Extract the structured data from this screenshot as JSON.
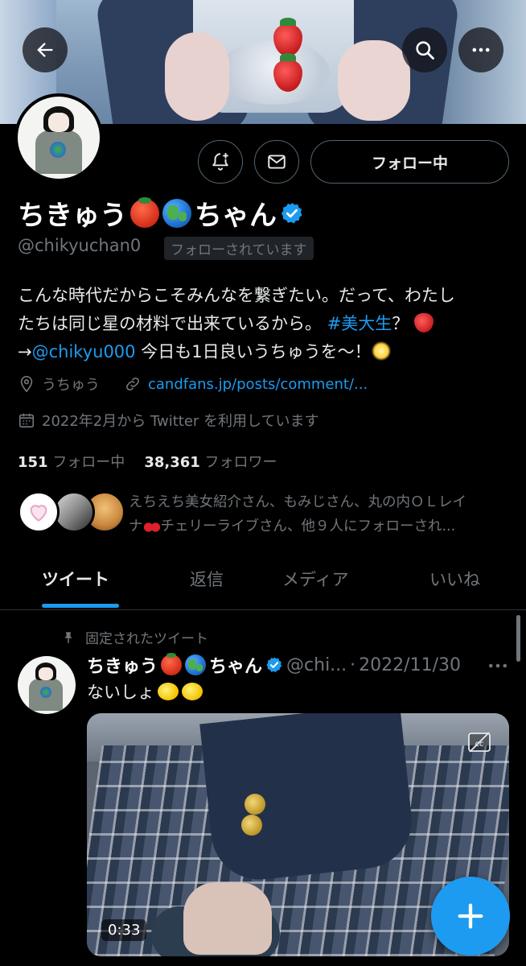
{
  "header": {
    "back_icon": "arrow-left-icon",
    "search_icon": "search-icon",
    "more_icon": "more-horizontal-icon"
  },
  "profile": {
    "name": "ちきゅう",
    "name_emojis": [
      "tomato",
      "globe-americas"
    ],
    "name_suffix": "ちゃん",
    "verified": true,
    "handle": "@chikyuchan0",
    "follows_you": "フォローされています",
    "follow_button": "フォロー中",
    "bio": {
      "line1": "こんな時代だからこそみんなを繋ぎたい。だって、わたし",
      "line2": "たちは同じ星の材料で出来ているから。",
      "hashtag": "#美大生",
      "hashtag_suffix": "？",
      "line3_prefix": "→",
      "mention": "@chikyu000",
      "line3_suffix": "今日も1日良いうちゅうを〜！"
    },
    "location": "うちゅう",
    "website": "candfans.jp/posts/comment/...",
    "joined": "2022年2月から Twitter を利用しています",
    "following_count": "151",
    "following_label": "フォロー中",
    "followers_count": "38,361",
    "followers_label": "フォロワー",
    "known_followers_line1": "えちえち美女紹介さん、もみじさん、丸の内ＯＬレイ",
    "known_followers_line2_a": "ナ",
    "known_followers_line2_b": "チェリーライブさん、他９人にフォローされ..."
  },
  "tabs": [
    {
      "label": "ツイート",
      "active": true
    },
    {
      "label": "返信",
      "active": false
    },
    {
      "label": "メディア",
      "active": false
    },
    {
      "label": "いいね",
      "active": false
    }
  ],
  "pinned_tweet": {
    "pinned_label": "固定されたツイート",
    "name": "ちきゅう",
    "name_suffix": "ちゃん",
    "handle": "@chi...",
    "separator": "·",
    "date": "2022/11/30",
    "text": "ないしょ",
    "text_emojis": [
      "lemon",
      "lemon"
    ],
    "video_duration": "0:33"
  },
  "colors": {
    "accent": "#1d9bf0",
    "background": "#000000",
    "secondary_text": "#71767b"
  }
}
